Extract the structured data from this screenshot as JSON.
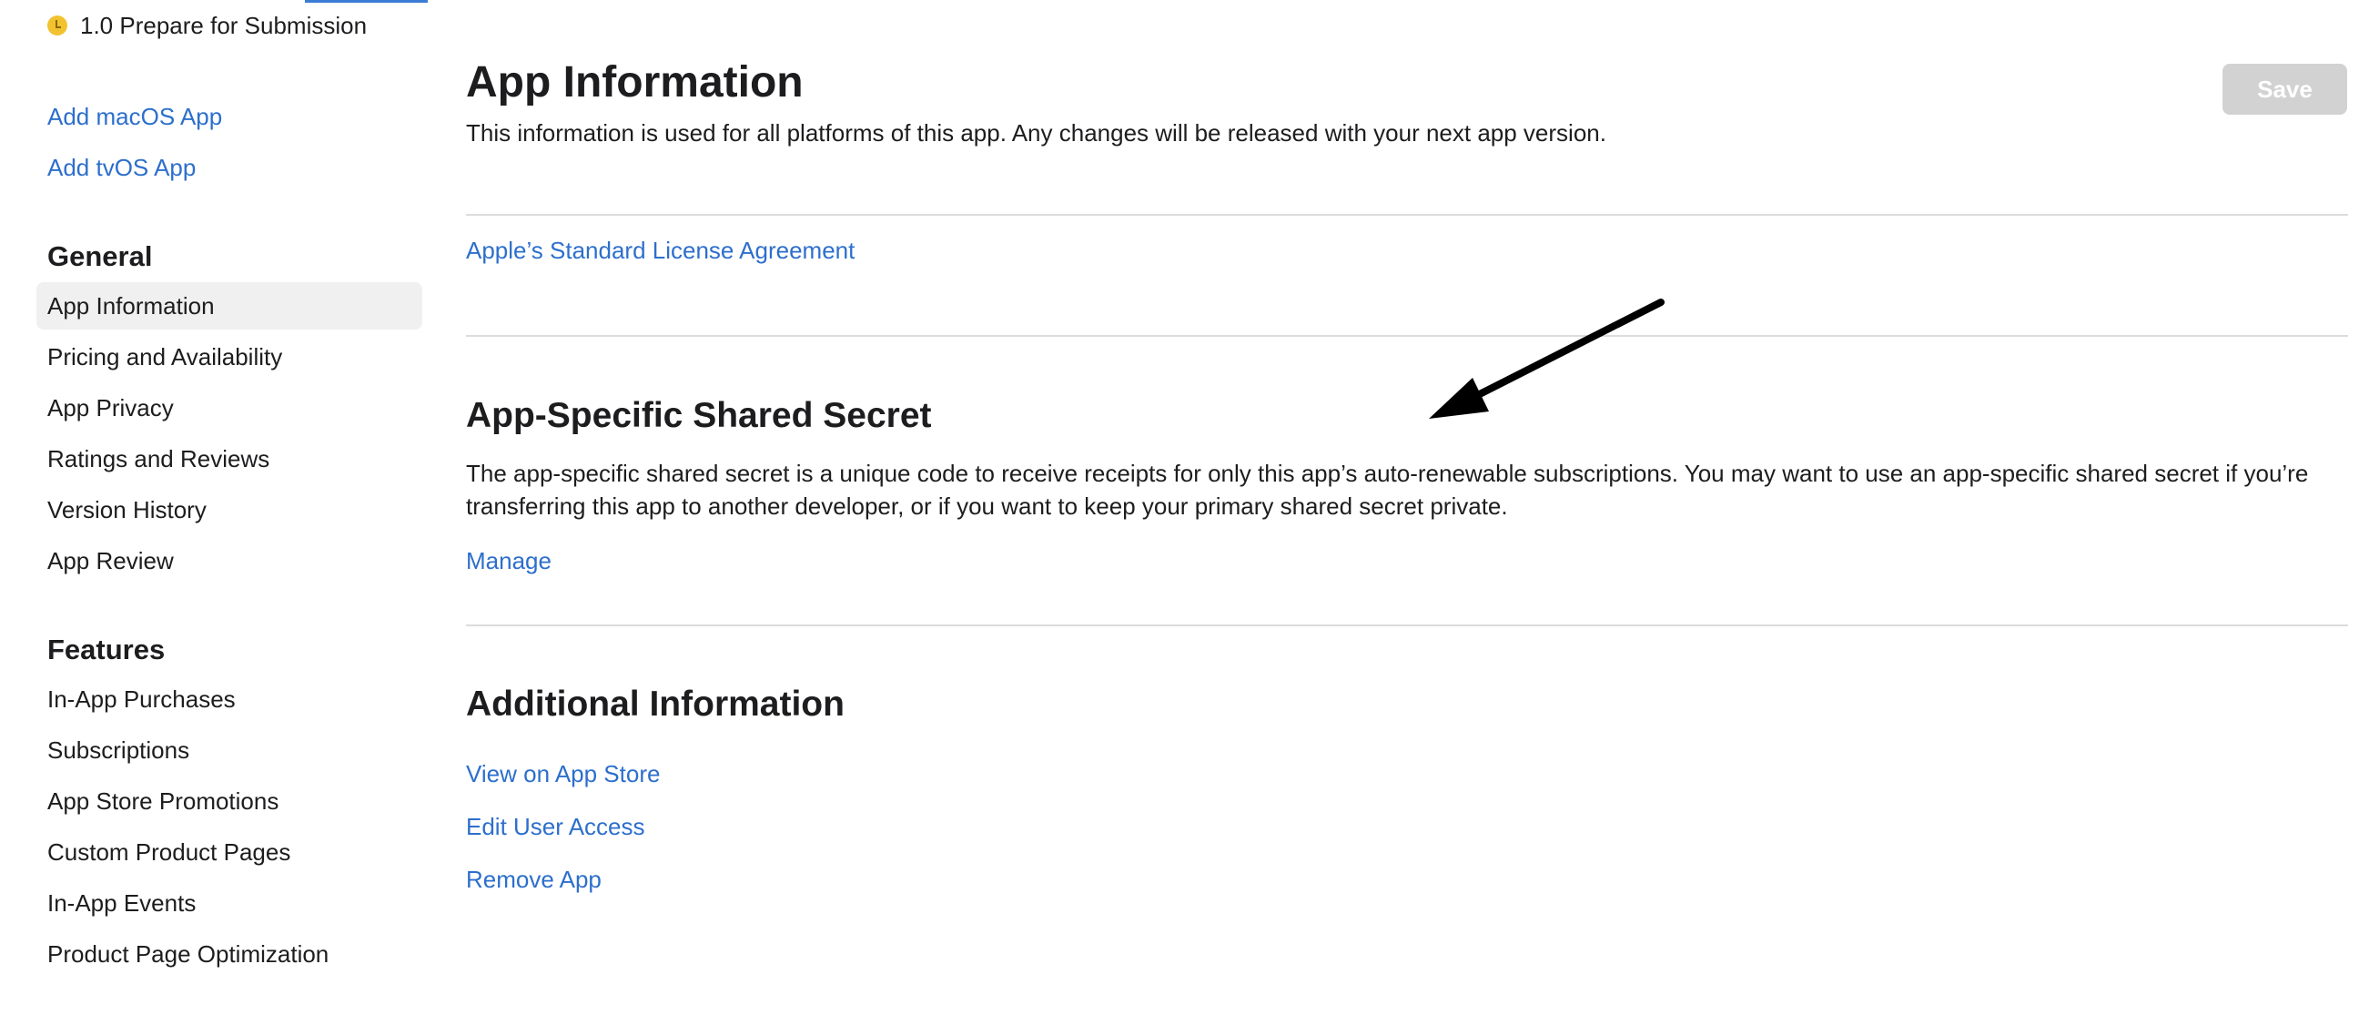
{
  "sidebar": {
    "version": {
      "label": "1.0 Prepare for Submission",
      "status_color": "#f2c230"
    },
    "add_links": [
      {
        "label": "Add macOS App"
      },
      {
        "label": "Add tvOS App"
      }
    ],
    "general": {
      "header": "General",
      "items": [
        {
          "label": "App Information",
          "selected": true
        },
        {
          "label": "Pricing and Availability"
        },
        {
          "label": "App Privacy"
        },
        {
          "label": "Ratings and Reviews"
        },
        {
          "label": "Version History"
        },
        {
          "label": "App Review"
        }
      ]
    },
    "features": {
      "header": "Features",
      "items": [
        {
          "label": "In-App Purchases"
        },
        {
          "label": "Subscriptions"
        },
        {
          "label": "App Store Promotions"
        },
        {
          "label": "Custom Product Pages"
        },
        {
          "label": "In-App Events"
        },
        {
          "label": "Product Page Optimization"
        }
      ]
    }
  },
  "main": {
    "title": "App Information",
    "subtitle": "This information is used for all platforms of this app. Any changes will be released with your next app version.",
    "save_label": "Save",
    "license_link": "Apple’s Standard License Agreement",
    "shared_secret": {
      "title": "App-Specific Shared Secret",
      "description": "The app-specific shared secret is a unique code to receive receipts for only this app’s auto-renewable subscriptions. You may want to use an app-specific shared secret if you’re transferring this app to another developer, or if you want to keep your primary shared secret private.",
      "manage_label": "Manage"
    },
    "additional": {
      "title": "Additional Information",
      "links": [
        {
          "label": "View on App Store"
        },
        {
          "label": "Edit User Access"
        },
        {
          "label": "Remove App"
        }
      ]
    }
  },
  "colors": {
    "link": "#2d6fcc",
    "selected_bg": "#f0f0f0",
    "save_disabled": "#d2d2d2"
  },
  "annotation": {
    "icon": "arrow-icon"
  }
}
